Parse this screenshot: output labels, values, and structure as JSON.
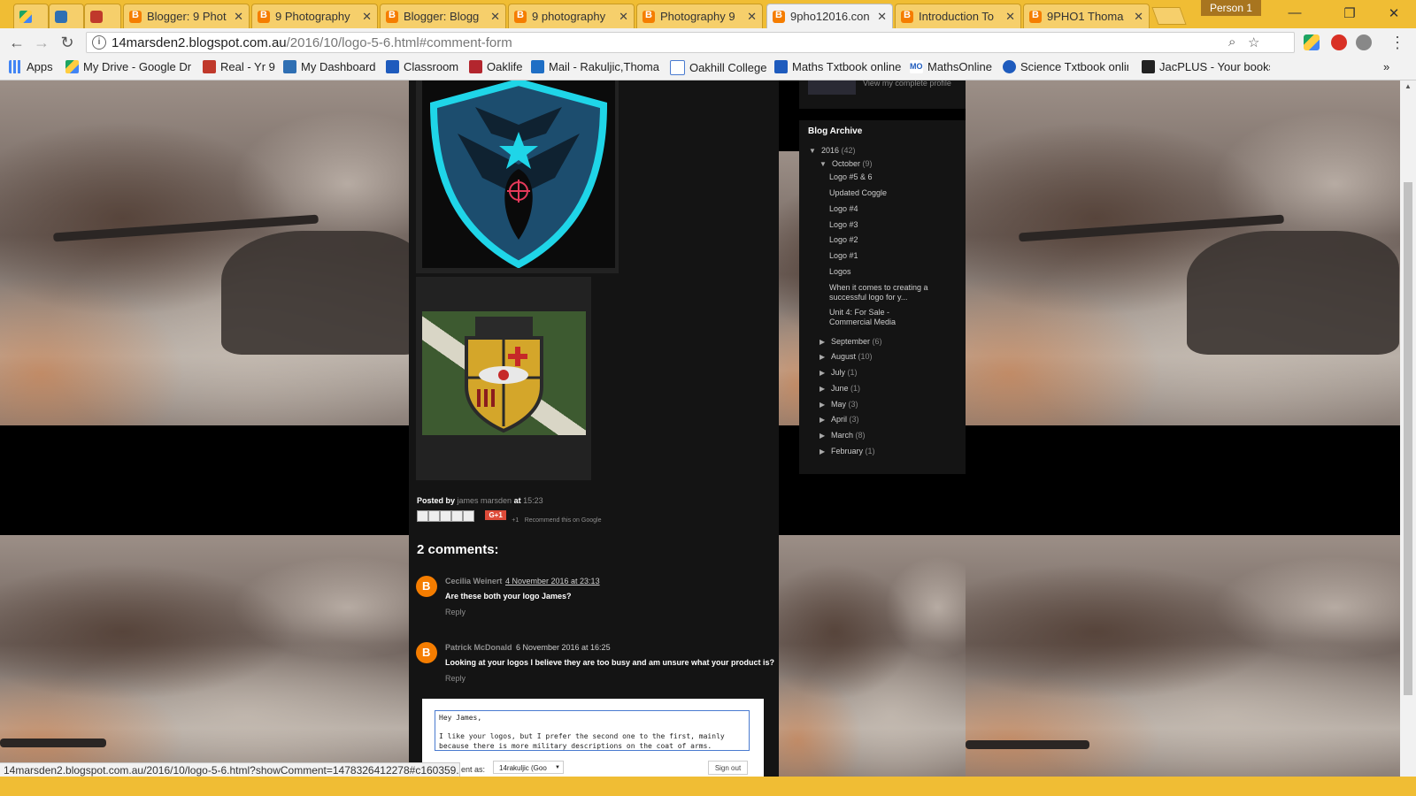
{
  "tabs": [
    {
      "label": "",
      "icon": "drive"
    },
    {
      "label": "",
      "icon": "bolt"
    },
    {
      "label": "",
      "icon": "red"
    },
    {
      "label": "Blogger: 9 Phot",
      "icon": "blogger"
    },
    {
      "label": "9 Photography",
      "icon": "blogger"
    },
    {
      "label": "Blogger: Blogg",
      "icon": "blogger"
    },
    {
      "label": "9 photography",
      "icon": "blogger"
    },
    {
      "label": "Photography 9",
      "icon": "blogger"
    },
    {
      "label": "9pho12016.con",
      "icon": "blogger",
      "active": true
    },
    {
      "label": "Introduction To",
      "icon": "blogger"
    },
    {
      "label": "9PHO1 Thoma",
      "icon": "blogger"
    }
  ],
  "window": {
    "person_label": "Person 1",
    "minimize": "—",
    "restore": "❐",
    "close": "✕"
  },
  "address": {
    "domain": "14marsden2.blogspot.com.au",
    "path": "/2016/10/logo-5-6.html#comment-form"
  },
  "bookmarks": [
    {
      "label": "Apps"
    },
    {
      "label": "My Drive - Google Dr"
    },
    {
      "label": "Real - Yr 9"
    },
    {
      "label": "My Dashboard"
    },
    {
      "label": "Classroom"
    },
    {
      "label": "Oaklife"
    },
    {
      "label": "Mail - Rakuljic,Thoma"
    },
    {
      "label": "Oakhill College"
    },
    {
      "label": "Maths Txtbook online"
    },
    {
      "label": "MathsOnline"
    },
    {
      "label": "Science Txtbook onlin"
    },
    {
      "label": "JacPLUS - Your books"
    }
  ],
  "profile": {
    "link": "View my complete profile"
  },
  "post": {
    "posted_by_prefix": "Posted by",
    "author": "james marsden",
    "at": "at",
    "time": "15:23",
    "share_plus_one": "+1",
    "recommend": "Recommend this on Google",
    "gplus": "G+1"
  },
  "comments": {
    "title": "2 comments:",
    "items": [
      {
        "author": "Cecilia Weinert",
        "date": "4 November 2016 at 23:13",
        "text": "Are these both your logo James?",
        "reply": "Reply"
      },
      {
        "author": "Patrick McDonald",
        "date": "6 November 2016 at 16:25",
        "text": "Looking at your logos I believe they are too busy and am unsure what your product is?",
        "reply": "Reply"
      }
    ],
    "form": {
      "text": "Hey James,\n\nI like your logos, but I prefer the second one to the first, mainly because there is more military descriptions on the coat of arms.",
      "comment_as_label": "ent as:",
      "identity": "14rakuljic (Goo",
      "sign_out": "Sign out"
    }
  },
  "archive": {
    "title": "Blog Archive",
    "year": {
      "label": "2016",
      "count": "(42)"
    },
    "month_open": {
      "label": "October",
      "count": "(9)"
    },
    "posts": [
      "Logo #5 & 6",
      "Updated Coggle",
      "Logo #4",
      "Logo #3",
      "Logo #2",
      "Logo #1",
      "Logos",
      "When it comes to creating a successful logo for y...",
      "Unit 4: For Sale - Commercial Media"
    ],
    "months": [
      {
        "label": "September",
        "count": "(6)"
      },
      {
        "label": "August",
        "count": "(10)"
      },
      {
        "label": "July",
        "count": "(1)"
      },
      {
        "label": "June",
        "count": "(1)"
      },
      {
        "label": "May",
        "count": "(3)"
      },
      {
        "label": "April",
        "count": "(3)"
      },
      {
        "label": "March",
        "count": "(8)"
      },
      {
        "label": "February",
        "count": "(1)"
      }
    ]
  },
  "status": {
    "url": "14marsden2.blogspot.com.au/2016/10/logo-5-6.html?showComment=1478326412278#c160359..."
  },
  "colors": {
    "tabstrip": "#f0bd34",
    "blogger": "#f57d00",
    "page_column": "#141414",
    "link_blue": "#4a7bd0"
  }
}
